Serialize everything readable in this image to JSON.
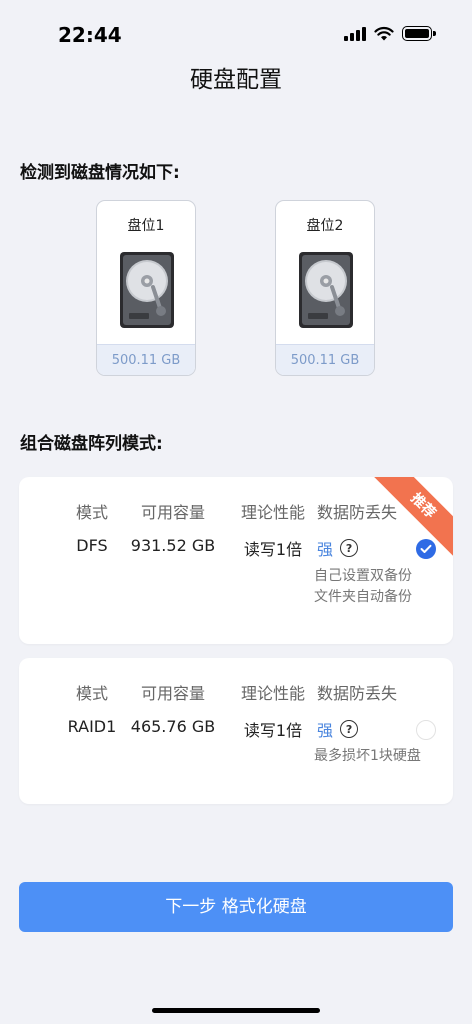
{
  "status": {
    "time": "22:44"
  },
  "page": {
    "title": "硬盘配置"
  },
  "detect": {
    "heading": "检测到磁盘情况如下:",
    "disks": [
      {
        "slot": "盘位1",
        "capacity": "500.11 GB",
        "icon": "hard-drive-icon"
      },
      {
        "slot": "盘位2",
        "capacity": "500.11 GB",
        "icon": "hard-drive-icon"
      }
    ]
  },
  "modes": {
    "heading": "组合磁盘阵列模式:",
    "columns": [
      "模式",
      "可用容量",
      "理论性能",
      "数据防丢失"
    ],
    "options": [
      {
        "mode": "DFS",
        "capacity": "931.52 GB",
        "performance": "读写1倍",
        "protection": "强",
        "description": "自己设置双备份 文件夹自动备份",
        "badge": "推荐",
        "selected": true
      },
      {
        "mode": "RAID1",
        "capacity": "465.76 GB",
        "performance": "读写1倍",
        "protection": "强",
        "description": "最多损坏1块硬盘",
        "selected": false
      }
    ]
  },
  "footer": {
    "next_label": "下一步 格式化硬盘"
  },
  "colors": {
    "accent": "#4d90f6",
    "check": "#2f6be5",
    "badge": "#f2734f",
    "strength": "#4a85de"
  }
}
